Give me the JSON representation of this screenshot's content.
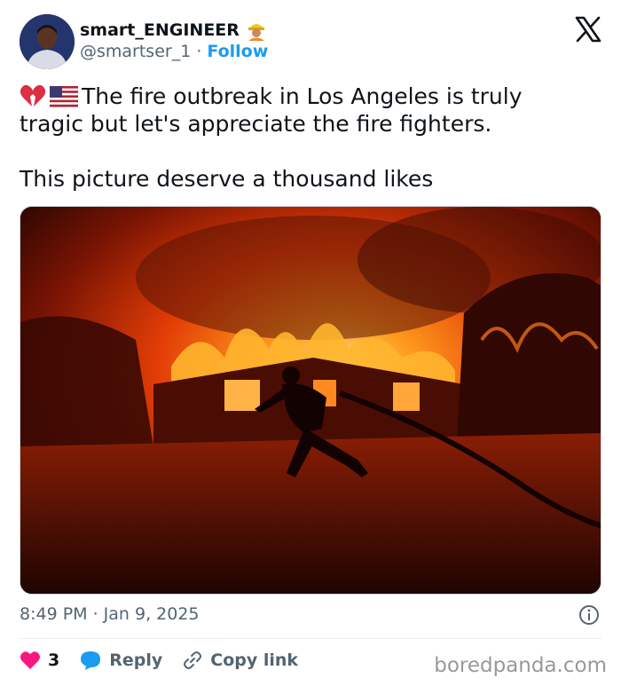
{
  "author": {
    "display_name": "smart_ENGINEER",
    "name_emoji": "construction-worker-emoji",
    "handle": "@smartser_1",
    "separator": "·",
    "follow_label": "Follow"
  },
  "platform_logo": "x-logo",
  "tweet": {
    "emojis": [
      "broken-heart-emoji",
      "us-flag-emoji"
    ],
    "line1": "The fire outbreak in Los Angeles is truly",
    "line2": "tragic but let's appreciate the fire fighters.",
    "line3": "This picture deserve a thousand likes"
  },
  "media": {
    "description_icon": "photo-firefighter-burning-house"
  },
  "meta": {
    "timestamp": "8:49 PM · Jan 9, 2025",
    "info_icon": "info-icon"
  },
  "actions": {
    "like_count": "3",
    "reply_label": "Reply",
    "copy_label": "Copy link"
  },
  "watermark": "boredpanda.com",
  "colors": {
    "accent": "#1d9bf0",
    "like": "#f91880",
    "text": "#0f1419",
    "muted": "#536471"
  }
}
